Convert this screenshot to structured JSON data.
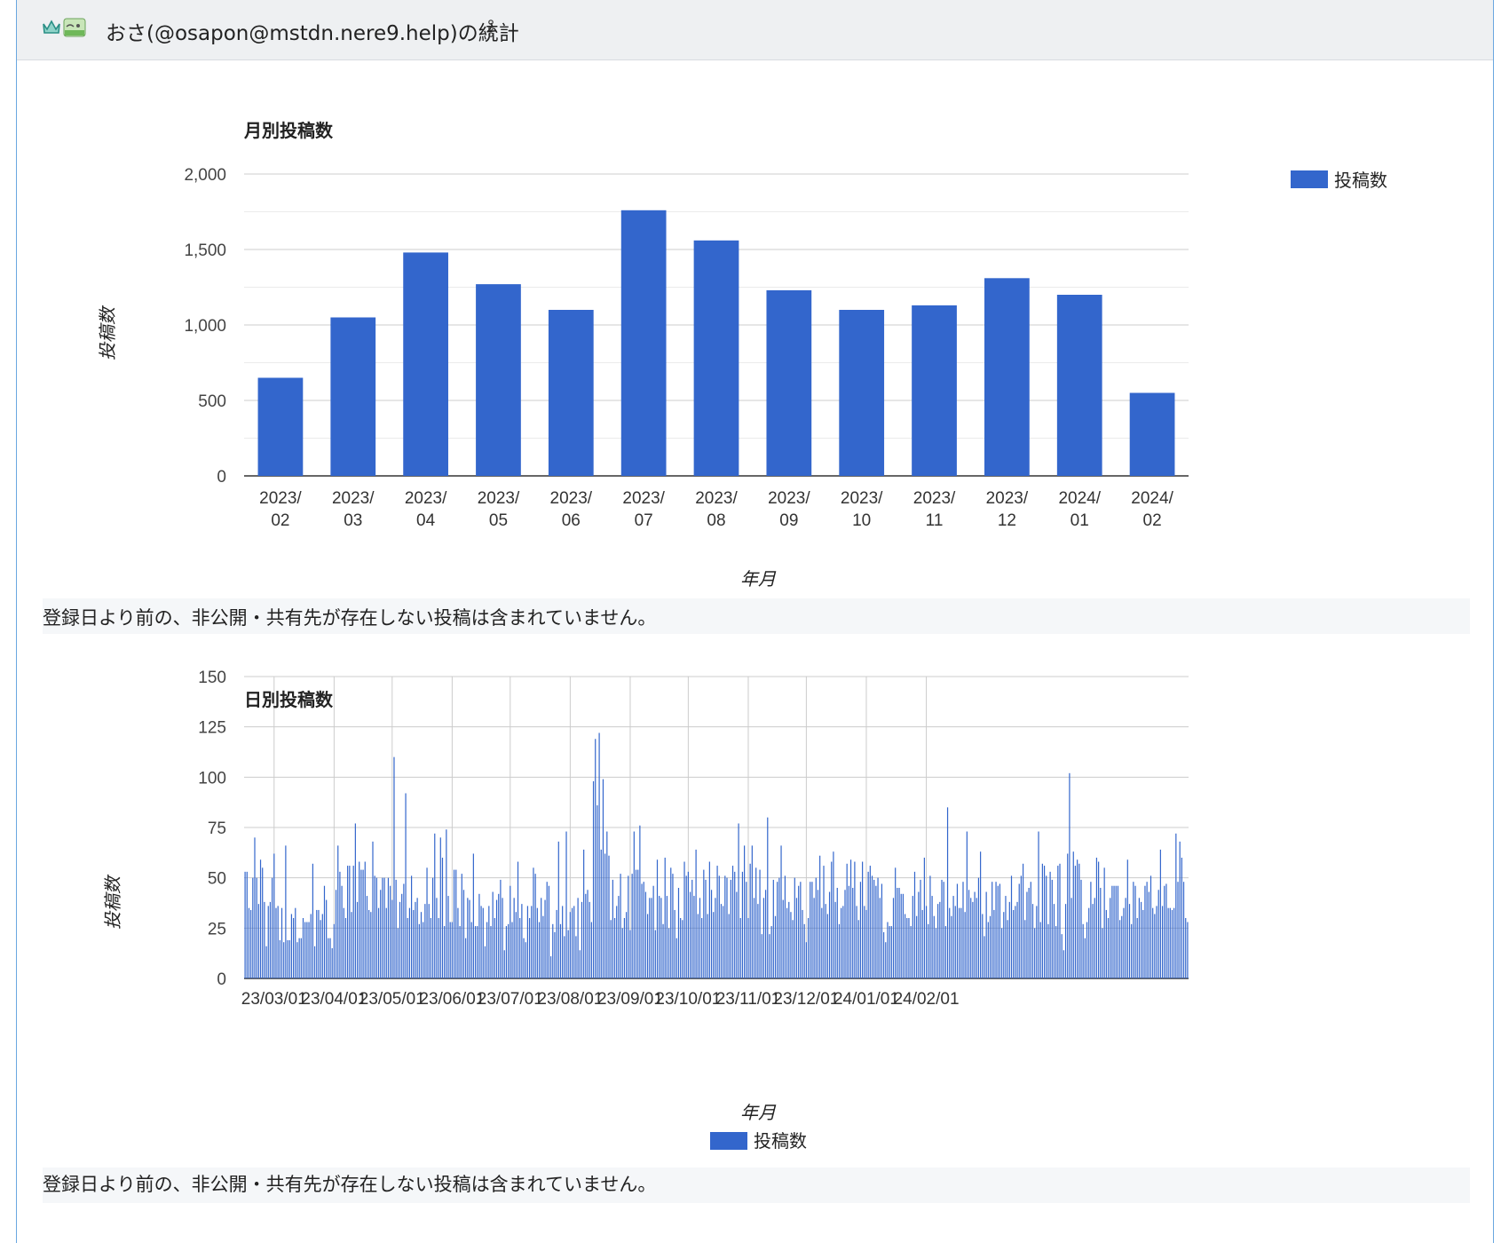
{
  "header": {
    "title": "おさ(@osapon@mstdn.nere9.help)の統計",
    "icon_crown": "crown-icon",
    "icon_avatar": "avatar-emoji-icon",
    "icon_menu": "kebab-menu-icon"
  },
  "colors": {
    "bar": "#3366cc",
    "frame": "#6aa7e0",
    "header_bg": "#eef0f2"
  },
  "monthly": {
    "note": "登録日より前の、非公開・共有先が存在しない投稿は含まれていません。"
  },
  "daily": {
    "note": "登録日より前の、非公開・共有先が存在しない投稿は含まれていません。"
  },
  "chart_data": [
    {
      "type": "bar",
      "title": "月別投稿数",
      "xlabel": "年月",
      "ylabel": "投稿数",
      "categories": [
        "2023/\n02",
        "2023/\n03",
        "2023/\n04",
        "2023/\n05",
        "2023/\n06",
        "2023/\n07",
        "2023/\n08",
        "2023/\n09",
        "2023/\n10",
        "2023/\n11",
        "2023/\n12",
        "2024/\n01",
        "2024/\n02"
      ],
      "series": [
        {
          "name": "投稿数",
          "values": [
            650,
            1050,
            1480,
            1270,
            1100,
            1760,
            1560,
            1230,
            1100,
            1130,
            1310,
            1200,
            550
          ]
        }
      ],
      "ylim": [
        0,
        2000
      ],
      "yticks": [
        "0",
        "500",
        "1,000",
        "1,500",
        "2,000"
      ],
      "grid": true,
      "legend": "right"
    },
    {
      "type": "bar",
      "title": "日別投稿数",
      "xlabel": "年月",
      "ylabel": "投稿数",
      "x_start": "2023-02-14",
      "xticks": [
        "23/03/01",
        "23/04/01",
        "23/05/01",
        "23/06/01",
        "23/07/01",
        "23/08/01",
        "23/09/01",
        "23/10/01",
        "23/11/01",
        "23/12/01",
        "24/01/01",
        "24/02/01"
      ],
      "series": [
        {
          "name": "投稿数",
          "values": [
            53,
            53,
            35,
            34,
            50,
            70,
            50,
            37,
            59,
            55,
            38,
            16,
            36,
            38,
            50,
            62,
            35,
            36,
            19,
            35,
            18,
            66,
            19,
            19,
            32,
            30,
            35,
            18,
            20,
            20,
            30,
            28,
            28,
            28,
            32,
            57,
            16,
            34,
            34,
            29,
            32,
            46,
            39,
            20,
            20,
            15,
            27,
            44,
            66,
            53,
            46,
            35,
            30,
            56,
            56,
            33,
            56,
            77,
            38,
            58,
            54,
            54,
            58,
            41,
            34,
            33,
            68,
            51,
            50,
            35,
            44,
            50,
            50,
            35,
            50,
            46,
            39,
            110,
            49,
            25,
            38,
            42,
            47,
            92,
            30,
            35,
            51,
            34,
            38,
            40,
            27,
            33,
            28,
            37,
            55,
            37,
            30,
            50,
            72,
            40,
            30,
            70,
            60,
            26,
            74,
            41,
            28,
            28,
            54,
            54,
            35,
            26,
            52,
            44,
            20,
            40,
            39,
            28,
            62,
            26,
            26,
            42,
            36,
            35,
            16,
            28,
            36,
            26,
            43,
            30,
            39,
            42,
            49,
            40,
            14,
            26,
            27,
            46,
            28,
            40,
            33,
            58,
            30,
            37,
            20,
            18,
            36,
            30,
            36,
            55,
            52,
            35,
            28,
            40,
            31,
            39,
            48,
            46,
            11,
            27,
            23,
            34,
            68,
            27,
            36,
            21,
            73,
            24,
            33,
            35,
            36,
            21,
            40,
            14,
            38,
            64,
            42,
            44,
            38,
            28,
            98,
            119,
            86,
            122,
            64,
            99,
            62,
            73,
            61,
            29,
            49,
            30,
            36,
            41,
            52,
            25,
            30,
            33,
            51,
            24,
            52,
            73,
            54,
            54,
            76,
            47,
            48,
            43,
            32,
            40,
            40,
            46,
            24,
            59,
            41,
            40,
            27,
            60,
            41,
            25,
            55,
            52,
            34,
            20,
            45,
            30,
            29,
            58,
            51,
            53,
            43,
            49,
            41,
            64,
            32,
            40,
            30,
            54,
            49,
            32,
            58,
            44,
            33,
            40,
            56,
            51,
            37,
            36,
            51,
            50,
            32,
            49,
            56,
            53,
            43,
            77,
            30,
            53,
            66,
            48,
            30,
            57,
            66,
            40,
            55,
            37,
            54,
            22,
            40,
            44,
            80,
            22,
            26,
            49,
            31,
            48,
            50,
            66,
            39,
            51,
            35,
            38,
            33,
            29,
            50,
            40,
            46,
            48,
            34,
            27,
            18,
            30,
            48,
            48,
            40,
            50,
            44,
            61,
            35,
            56,
            37,
            32,
            43,
            58,
            63,
            38,
            45,
            27,
            35,
            36,
            44,
            57,
            46,
            59,
            45,
            58,
            36,
            29,
            48,
            58,
            36,
            34,
            53,
            56,
            51,
            49,
            46,
            50,
            40,
            47,
            23,
            18,
            28,
            26,
            26,
            40,
            55,
            45,
            45,
            42,
            42,
            32,
            30,
            30,
            26,
            41,
            53,
            31,
            43,
            49,
            34,
            60,
            36,
            27,
            51,
            41,
            31,
            25,
            37,
            38,
            49,
            48,
            26,
            85,
            35,
            31,
            41,
            36,
            47,
            35,
            35,
            48,
            33,
            73,
            44,
            40,
            38,
            43,
            40,
            50,
            63,
            32,
            21,
            43,
            28,
            31,
            48,
            34,
            48,
            46,
            47,
            25,
            33,
            41,
            29,
            38,
            51,
            34,
            36,
            38,
            47,
            51,
            57,
            29,
            43,
            45,
            48,
            37,
            25,
            36,
            73,
            28,
            57,
            56,
            51,
            27,
            53,
            49,
            37,
            26,
            56,
            57,
            22,
            14,
            37,
            62,
            102,
            40,
            63,
            56,
            59,
            57,
            49,
            27,
            20,
            28,
            35,
            48,
            37,
            40,
            60,
            58,
            45,
            25,
            55,
            34,
            30,
            40,
            46,
            46,
            46,
            46,
            29,
            31,
            35,
            40,
            59,
            37,
            27,
            48,
            46,
            30,
            40,
            38,
            34,
            46,
            48,
            43,
            51,
            35,
            32,
            36,
            44,
            64,
            36,
            46,
            47,
            35,
            35,
            34,
            35,
            72,
            48,
            68,
            60,
            48,
            30,
            28
          ]
        }
      ],
      "ylim": [
        0,
        150
      ],
      "yticks": [
        "0",
        "25",
        "50",
        "75",
        "100",
        "125",
        "150"
      ],
      "grid": true,
      "legend": "bottom"
    }
  ]
}
